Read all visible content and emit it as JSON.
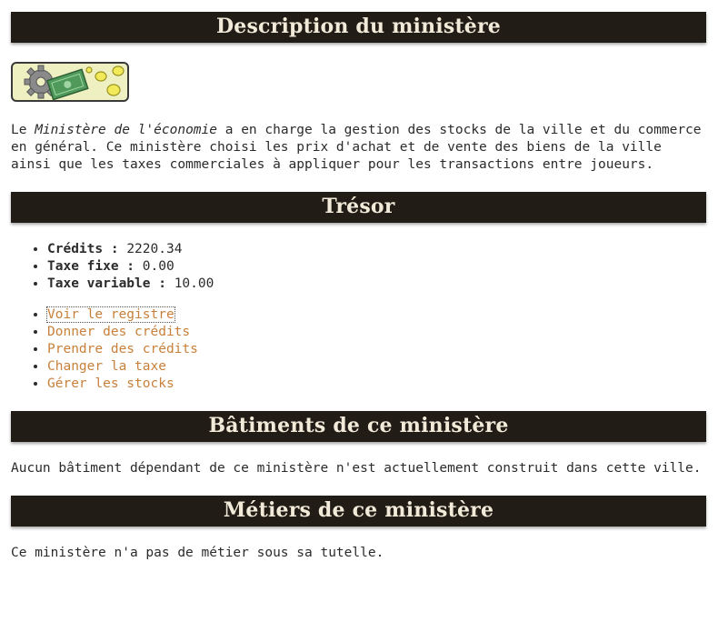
{
  "sections": {
    "description_title": "Description du ministère",
    "tresor_title": "Trésor",
    "batiments_title": "Bâtiments de ce ministère",
    "metiers_title": "Métiers de ce ministère"
  },
  "description": {
    "before": "Le ",
    "ministry_name": "Ministère de l'économie",
    "after": " a en charge la gestion des stocks de la ville et du commerce en général. Ce ministère choisi les prix d'achat et de vente des biens de la ville ainsi que les taxes commerciales à appliquer pour les transactions entre joueurs."
  },
  "tresor": {
    "stats": [
      {
        "label": "Crédits",
        "value": "2220.34"
      },
      {
        "label": "Taxe fixe",
        "value": "0.00"
      },
      {
        "label": "Taxe variable",
        "value": "10.00"
      }
    ],
    "separator": " : ",
    "actions": [
      "Voir le registre",
      "Donner des crédits",
      "Prendre des crédits",
      "Changer la taxe",
      "Gérer les stocks"
    ]
  },
  "batiments_text": "Aucun bâtiment dépendant de ce ministère n'est actuellement construit dans cette ville.",
  "metiers_text": "Ce ministère n'a pas de métier sous sa tutelle.",
  "colors": {
    "header_bg": "#221c17",
    "header_text": "#f2ead8",
    "link": "#c8803a"
  },
  "icons": {
    "emblem": "economy-emblem-icon"
  }
}
